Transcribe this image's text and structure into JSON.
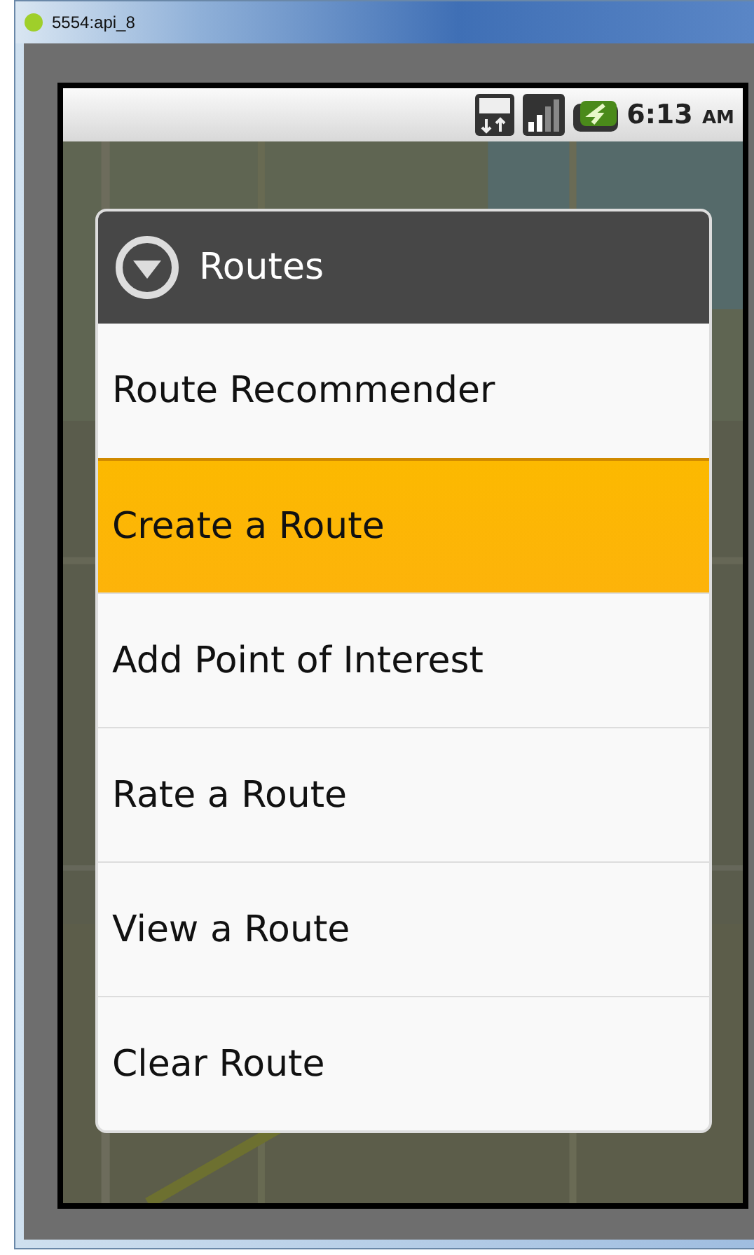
{
  "window": {
    "title": "5554:api_8"
  },
  "status_bar": {
    "time": "6:13",
    "meridiem": "AM"
  },
  "dialog": {
    "title": "Routes",
    "items": [
      {
        "label": "Route Recommender",
        "selected": false
      },
      {
        "label": "Create a Route",
        "selected": true
      },
      {
        "label": "Add Point of Interest",
        "selected": false
      },
      {
        "label": "Rate a Route",
        "selected": false
      },
      {
        "label": "View a Route",
        "selected": false
      },
      {
        "label": "Clear Route",
        "selected": false
      }
    ]
  }
}
